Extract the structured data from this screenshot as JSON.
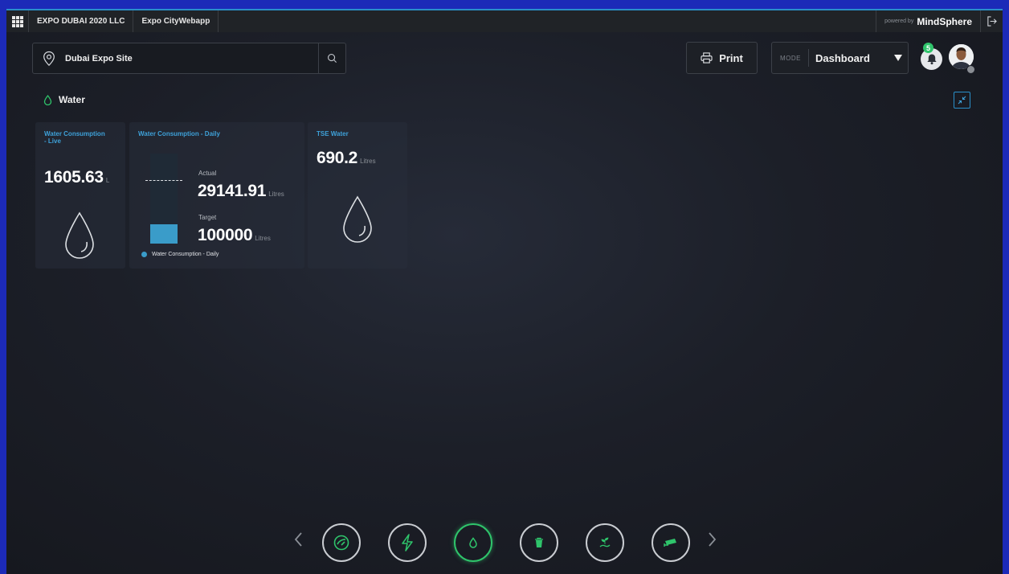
{
  "topbar": {
    "company": "EXPO DUBAI 2020 LLC",
    "app": "Expo CityWebapp",
    "powered_by": "powered by",
    "brand": "MindSphere"
  },
  "header": {
    "location": "Dubai Expo Site",
    "print_label": "Print",
    "mode_label": "MODE",
    "mode_value": "Dashboard",
    "notification_count": "5"
  },
  "section": {
    "title": "Water"
  },
  "cards": {
    "live": {
      "title": "Water Consumption - Live",
      "value": "1605.63",
      "unit": "L"
    },
    "daily": {
      "title": "Water Consumption - Daily",
      "actual_label": "Actual",
      "actual_value": "29141.91",
      "actual_unit": "Litres",
      "target_label": "Target",
      "target_value": "100000",
      "target_unit": "Litres",
      "legend": "Water Consumption - Daily",
      "progress_fraction": 0.2914
    },
    "tse": {
      "title": "TSE Water",
      "value": "690.2",
      "unit": "Litres"
    }
  },
  "nav": {
    "items": [
      {
        "icon": "gas-icon",
        "active": false
      },
      {
        "icon": "electricity-icon",
        "active": false
      },
      {
        "icon": "water-icon",
        "active": true
      },
      {
        "icon": "waste-icon",
        "active": false
      },
      {
        "icon": "irrigation-icon",
        "active": false
      },
      {
        "icon": "cctv-icon",
        "active": false
      }
    ]
  },
  "colors": {
    "accent_blue": "#2a8fc9",
    "accent_green": "#2fc46b",
    "bar_fill": "#3a9cc9"
  }
}
